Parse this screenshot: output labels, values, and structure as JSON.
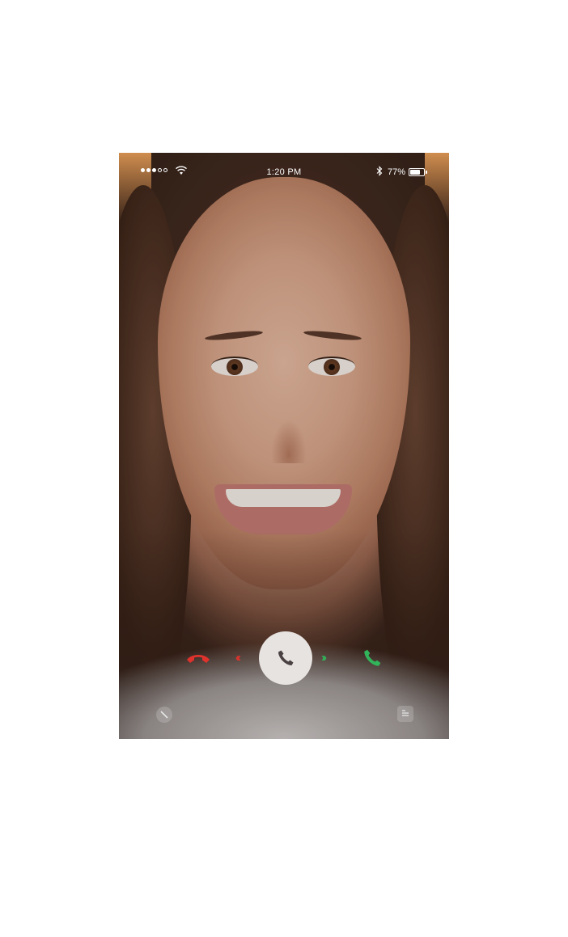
{
  "status_bar": {
    "signal_dots_filled": 3,
    "signal_dots_total": 5,
    "time": "1:20 PM",
    "battery_percent_label": "77%",
    "battery_level": 0.77,
    "icons": [
      "wifi-icon",
      "bluetooth-icon",
      "battery-icon"
    ]
  },
  "call": {
    "decline_icon": "phone-hangup-icon",
    "decline_color": "#e0322c",
    "slide_left_glyph": "‹‹",
    "slider_icon": "phone-icon",
    "slide_right_glyph": "››",
    "accept_icon": "phone-icon",
    "accept_color": "#32b45a"
  },
  "bottom_actions": {
    "left_icon": "mute-icon",
    "right_icon": "message-icon"
  }
}
